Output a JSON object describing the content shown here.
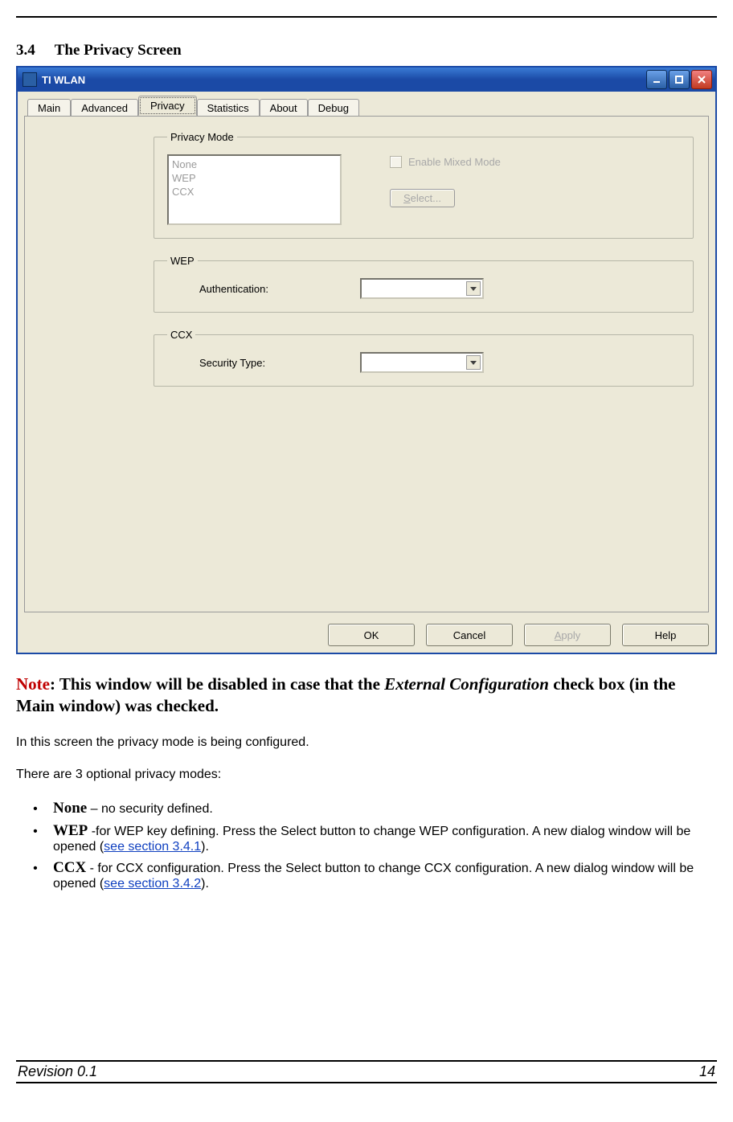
{
  "section": {
    "number": "3.4",
    "title": "The Privacy Screen"
  },
  "window": {
    "title": "TI WLAN",
    "tabs": [
      "Main",
      "Advanced",
      "Privacy",
      "Statistics",
      "About",
      "Debug"
    ],
    "active_tab_index": 2,
    "groups": {
      "privacy_mode": {
        "legend": "Privacy Mode",
        "options": [
          "None",
          "WEP",
          "CCX"
        ],
        "checkbox_label": "Enable Mixed Mode",
        "select_button_prefix": "S",
        "select_button_suffix": "elect..."
      },
      "wep": {
        "legend": "WEP",
        "field_label": "Authentication:"
      },
      "ccx": {
        "legend": "CCX",
        "field_label": "Security Type:"
      }
    },
    "buttons": {
      "ok": "OK",
      "cancel": "Cancel",
      "apply_prefix": "A",
      "apply_suffix": "pply",
      "help": "Help"
    }
  },
  "note": {
    "label": "Note",
    "text_before_italic": ": This window will be disabled in case that the ",
    "italic": "External Configuration",
    "text_after_italic": " check box (in the Main window) was checked."
  },
  "paragraphs": {
    "p1": "In this screen the privacy mode is being configured.",
    "p2": "There are 3 optional privacy modes:"
  },
  "bullets": {
    "none": {
      "term": "None",
      "dash": " – ",
      "text": "no security defined."
    },
    "wep": {
      "term": "WEP",
      "text_before_link": " -for WEP key defining. Press the Select button to change WEP configuration. A new dialog window will be opened (",
      "link": "see section 3.4.1",
      "text_after_link": ")."
    },
    "ccx": {
      "term": "CCX",
      "text_before_link": " - for CCX configuration. Press the Select button to change CCX configuration. A new dialog window will be opened (",
      "link": "see section 3.4.2",
      "text_after_link": ")."
    }
  },
  "footer": {
    "left": "Revision 0.1",
    "right": "14"
  }
}
